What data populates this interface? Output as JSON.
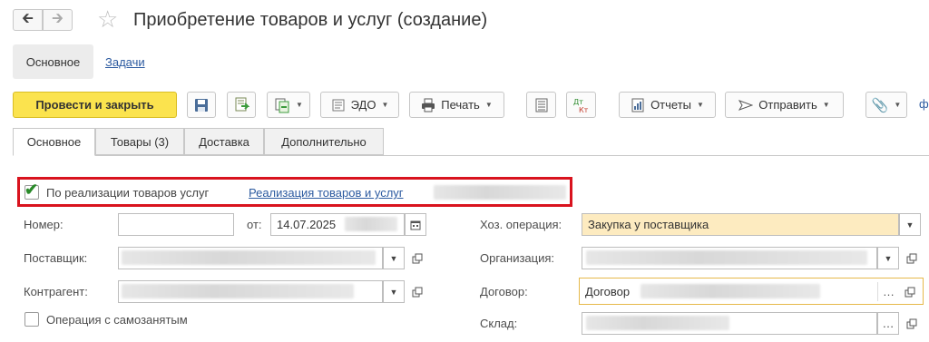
{
  "window": {
    "title": "Приобретение товаров и услуг (создание)",
    "back_icon": "arrow-left-icon",
    "forward_icon": "arrow-right-icon",
    "favorite_icon": "star-icon"
  },
  "sections": {
    "main": "Основное",
    "tasks": "Задачи"
  },
  "toolbar": {
    "post_close": "Провести и закрыть",
    "edo": "ЭДО",
    "print": "Печать",
    "reports": "Отчеты",
    "send": "Отправить"
  },
  "tabs": [
    "Основное",
    "Товары (3)",
    "Доставка",
    "Дополнительно"
  ],
  "basis": {
    "checkbox_label": "По реализации товаров услуг",
    "checked": true,
    "link_text": "Реализация товаров и услуг"
  },
  "form": {
    "number_label": "Номер:",
    "number_value": "",
    "date_label": "от:",
    "date_value": "14.07.2025",
    "supplier_label": "Поставщик:",
    "counterparty_label": "Контрагент:",
    "self_employed_label": "Операция с самозанятым",
    "self_employed_checked": false,
    "operation_label": "Хоз. операция:",
    "operation_value": "Закупка у поставщика",
    "organization_label": "Организация:",
    "contract_label": "Договор:",
    "contract_value": "Договор",
    "warehouse_label": "Склад:"
  },
  "colors": {
    "primary_button": "#fbe34e",
    "highlight_border": "#d9131e",
    "link": "#2c5aa0",
    "operation_field": "#fdebc0"
  }
}
